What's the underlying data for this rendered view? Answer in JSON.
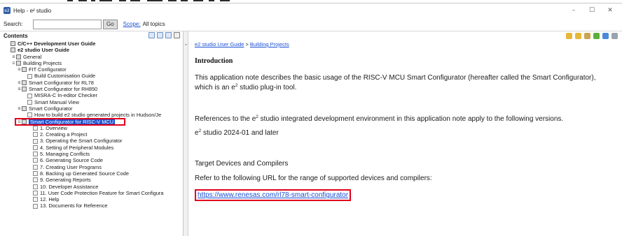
{
  "window": {
    "title": "Help - e² studio",
    "app_icon": "e2",
    "controls": {
      "minimize": "–",
      "maximize": "☐",
      "close": "✕"
    }
  },
  "searchbar": {
    "label": "Search:",
    "value": "",
    "go_label": "Go",
    "scope_link": "Scope:",
    "scope_value": "All topics"
  },
  "toc": {
    "header": "Contents",
    "items": [
      {
        "label": "C/C++ Development User Guide",
        "bold": true,
        "exp": ""
      },
      {
        "label": "e2 studio User Guide",
        "bold": true,
        "exp": ""
      },
      {
        "label": "General",
        "exp": "⊞"
      },
      {
        "label": "Building Projects",
        "exp": "⊟"
      },
      {
        "label": "FIT Configurator",
        "exp": "⊞"
      },
      {
        "label": "Build Customisation Guide",
        "exp": ""
      },
      {
        "label": "Smart Configurator for RL78",
        "exp": "⊞"
      },
      {
        "label": "Smart Configurator for RH850",
        "exp": "⊞"
      },
      {
        "label": "MISRA-C In-editor Checker",
        "exp": ""
      },
      {
        "label": "Smart Manual View",
        "exp": ""
      },
      {
        "label": "Smart Configurator",
        "exp": "⊞"
      },
      {
        "label": "How to build e2 studio generated projects in Hudson/Je",
        "exp": ""
      },
      {
        "label": "Smart Configurator for RISC-V MCU",
        "exp": "⊟",
        "selected": true
      },
      {
        "label": "1. Overview",
        "exp": ""
      },
      {
        "label": "2. Creating a Project",
        "exp": ""
      },
      {
        "label": "3. Operating the Smart Configurator",
        "exp": ""
      },
      {
        "label": "4. Setting of Peripheral Modules",
        "exp": ""
      },
      {
        "label": "5. Managing Conflicts",
        "exp": ""
      },
      {
        "label": "6. Generating Source Code",
        "exp": ""
      },
      {
        "label": "7. Creating User Programs",
        "exp": ""
      },
      {
        "label": "8. Backing up Generated Source Code",
        "exp": ""
      },
      {
        "label": "9. Generating Reports",
        "exp": ""
      },
      {
        "label": "10. Developer Assistance",
        "exp": ""
      },
      {
        "label": "11. User Code Protection Feature for Smart Configura",
        "exp": ""
      },
      {
        "label": "12. Help",
        "exp": ""
      },
      {
        "label": "13. Documents for Reference",
        "exp": ""
      }
    ]
  },
  "content": {
    "breadcrumb": [
      "e2 studio User Guide",
      "Building Projects"
    ],
    "breadcrumb_sep": ">",
    "heading": "Introduction",
    "para1_a": "This application note describes the basic usage of the RISC-V MCU Smart Configurator (hereafter called the Smart Configurator),",
    "para1_b_pre": "which is an e",
    "para1_b_sup": "2",
    "para1_b_post": " studio plug-in tool.",
    "para2_pre": "References to the e",
    "para2_sup": "2",
    "para2_post": " studio integrated development environment in this application note apply to the following versions.",
    "version_pre": "e",
    "version_sup": "2",
    "version_post": " studio 2024-01 and later",
    "devices_heading": "Target Devices and Compilers",
    "devices_text": "Refer to the following URL for the range of supported devices and compilers:",
    "url": "https://www.renesas.com/rl78-smart-configurator"
  },
  "colors": {
    "link": "#1a4fd6",
    "selection": "#1d4fcf",
    "highlight_box": "#e0001b"
  },
  "icons": {
    "content_toolbar": [
      "back-arrow-icon",
      "forward-arrow-icon",
      "home-icon",
      "sync-toc-icon",
      "bookmark-icon",
      "print-icon"
    ],
    "toc_toolbar": [
      "link-icon",
      "collapse-icon",
      "menu-icon",
      "view-icon"
    ]
  }
}
